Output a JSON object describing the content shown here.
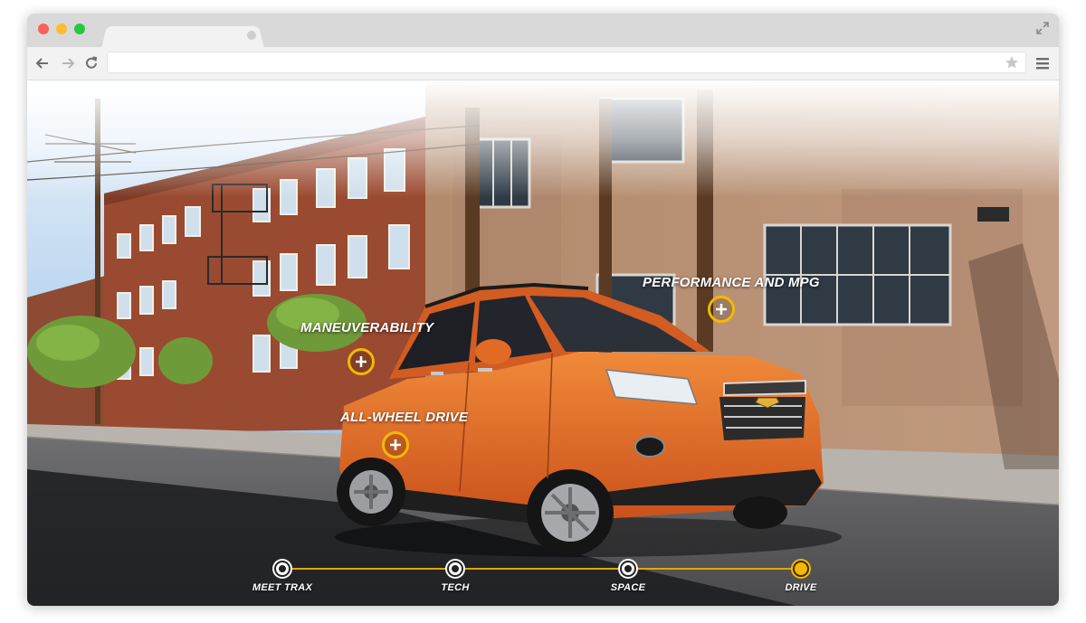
{
  "browser": {
    "address_value": "",
    "icons": [
      "back-arrow-icon",
      "forward-arrow-icon",
      "reload-icon",
      "star-icon",
      "menu-icon",
      "expand-icon"
    ]
  },
  "hotspots": {
    "performance": "PERFORMANCE AND MPG",
    "maneuverability": "MANEUVERABILITY",
    "awd": "ALL-WHEEL DRIVE"
  },
  "timeline": {
    "steps": [
      {
        "label": "MEET TRAX"
      },
      {
        "label": "TECH"
      },
      {
        "label": "SPACE"
      },
      {
        "label": "DRIVE"
      }
    ],
    "active_step": "DRIVE"
  },
  "colors": {
    "accent": "#f5b800",
    "car_body": "#e0641e",
    "building_brick": "#9a4a30"
  }
}
